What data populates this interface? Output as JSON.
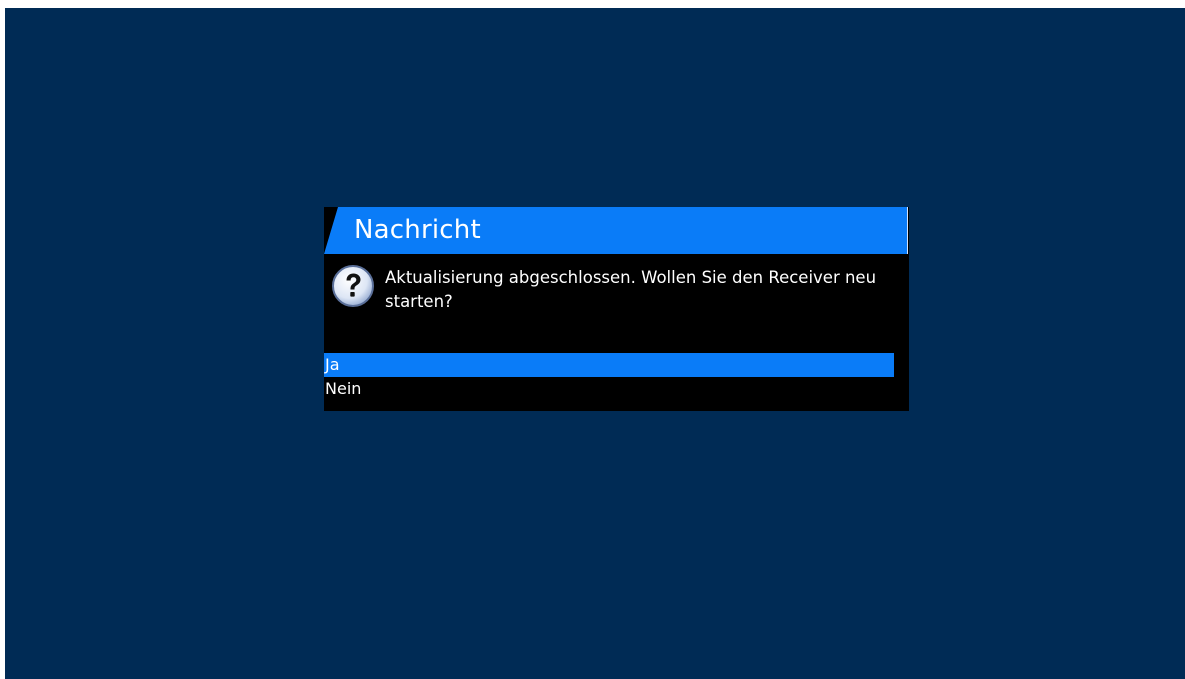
{
  "dialog": {
    "title": "Nachricht",
    "icon": "question-icon",
    "message": "Aktualisierung abgeschlossen. Wollen Sie den Receiver neu starten?",
    "options": [
      {
        "label": "Ja",
        "selected": true
      },
      {
        "label": "Nein",
        "selected": false
      }
    ]
  },
  "colors": {
    "background": "#002b55",
    "accent": "#0a7cf8",
    "dialog_bg": "#000000",
    "text": "#ffffff"
  }
}
